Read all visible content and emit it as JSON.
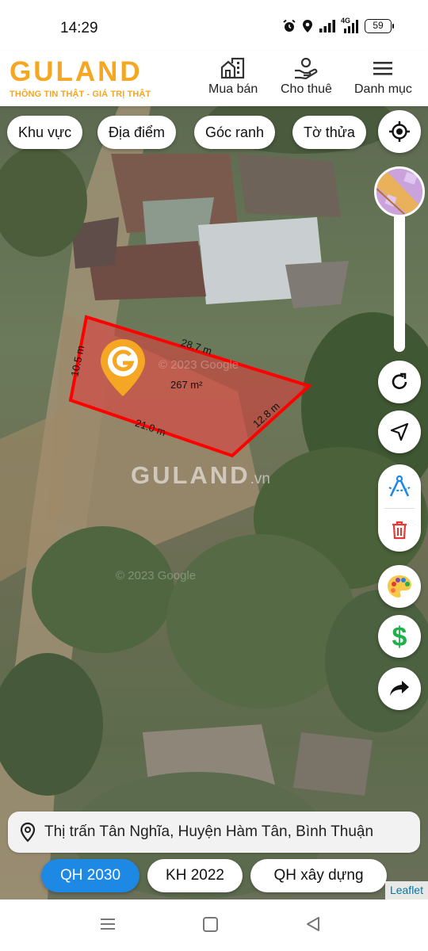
{
  "status_bar": {
    "time": "14:29",
    "network": "4G",
    "battery": "59",
    "icons": [
      "alarm-icon",
      "location-icon",
      "signal-icon",
      "signal-4g-icon",
      "battery-icon"
    ]
  },
  "header": {
    "logo_text": "GULAND",
    "tagline": "THÔNG TIN THẬT - GIÁ TRỊ THẬT",
    "nav": [
      {
        "label": "Mua bán",
        "icon": "buildings-icon"
      },
      {
        "label": "Cho thuê",
        "icon": "hand-person-icon"
      },
      {
        "label": "Danh mục",
        "icon": "menu-icon"
      }
    ]
  },
  "filter_chips": [
    "Khu vực",
    "Địa điểm",
    "Góc ranh",
    "Tờ thửa"
  ],
  "parcel": {
    "area": "267 m²",
    "edges": [
      "28.7 m",
      "12.8 m",
      "21.0 m",
      "10.5 m"
    ],
    "outline_color": "#ff0000",
    "fill_color": "#e23a3a"
  },
  "watermark": {
    "brand": "GULAND",
    "suffix": ".vn"
  },
  "map_copyright": [
    "© 2023 Google",
    "© 2023 Google"
  ],
  "side_controls": [
    "locate-icon",
    "layers-thumbnail",
    "refresh-icon",
    "navigate-icon",
    "compass-measure-icon",
    "trash-icon",
    "palette-icon",
    "dollar-icon",
    "share-icon"
  ],
  "address": "Thị trấn Tân Nghĩa, Huyện Hàm Tân, Bình Thuận",
  "plan_tabs": [
    {
      "label": "QH 2030",
      "active": true
    },
    {
      "label": "KH 2022",
      "active": false
    },
    {
      "label": "QH xây dựng",
      "active": false
    }
  ],
  "attribution": "Leaflet",
  "colors": {
    "brand": "#f5a623",
    "accent": "#1e88e5",
    "dollar": "#22b04a"
  }
}
